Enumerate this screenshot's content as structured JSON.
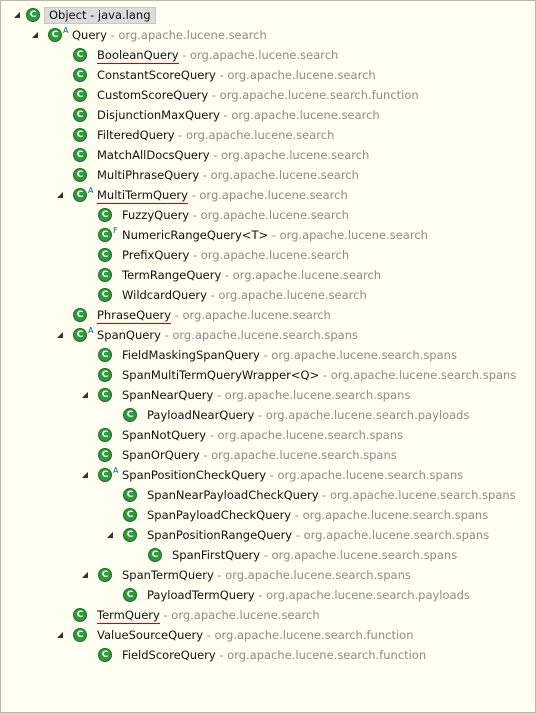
{
  "root": {
    "label": "Object - java.lang"
  },
  "rows": [
    {
      "id": "query",
      "name": "Query",
      "pkg": "org.apache.lucene.search",
      "level": 1,
      "expand": "open",
      "mod": "A",
      "underline": false
    },
    {
      "id": "boolean-query",
      "name": "BooleanQuery",
      "pkg": "org.apache.lucene.search",
      "level": 2,
      "expand": "none",
      "mod": "",
      "underline": true
    },
    {
      "id": "constant-score-query",
      "name": "ConstantScoreQuery",
      "pkg": "org.apache.lucene.search",
      "level": 2,
      "expand": "none",
      "mod": "",
      "underline": false
    },
    {
      "id": "custom-score-query",
      "name": "CustomScoreQuery",
      "pkg": "org.apache.lucene.search.function",
      "level": 2,
      "expand": "none",
      "mod": "",
      "underline": false
    },
    {
      "id": "disjunction-max-query",
      "name": "DisjunctionMaxQuery",
      "pkg": "org.apache.lucene.search",
      "level": 2,
      "expand": "none",
      "mod": "",
      "underline": false
    },
    {
      "id": "filtered-query",
      "name": "FilteredQuery",
      "pkg": "org.apache.lucene.search",
      "level": 2,
      "expand": "none",
      "mod": "",
      "underline": false
    },
    {
      "id": "match-all-docs-query",
      "name": "MatchAllDocsQuery",
      "pkg": "org.apache.lucene.search",
      "level": 2,
      "expand": "none",
      "mod": "",
      "underline": false
    },
    {
      "id": "multi-phrase-query",
      "name": "MultiPhraseQuery",
      "pkg": "org.apache.lucene.search",
      "level": 2,
      "expand": "none",
      "mod": "",
      "underline": false
    },
    {
      "id": "multi-term-query",
      "name": "MultiTermQuery",
      "pkg": "org.apache.lucene.search",
      "level": 2,
      "expand": "open",
      "mod": "A",
      "underline": true
    },
    {
      "id": "fuzzy-query",
      "name": "FuzzyQuery",
      "pkg": "org.apache.lucene.search",
      "level": 3,
      "expand": "none",
      "mod": "",
      "underline": false
    },
    {
      "id": "numeric-range-query",
      "name": "NumericRangeQuery<T>",
      "pkg": "org.apache.lucene.search",
      "level": 3,
      "expand": "none",
      "mod": "F",
      "underline": false
    },
    {
      "id": "prefix-query",
      "name": "PrefixQuery",
      "pkg": "org.apache.lucene.search",
      "level": 3,
      "expand": "none",
      "mod": "",
      "underline": false
    },
    {
      "id": "term-range-query",
      "name": "TermRangeQuery",
      "pkg": "org.apache.lucene.search",
      "level": 3,
      "expand": "none",
      "mod": "",
      "underline": false
    },
    {
      "id": "wildcard-query",
      "name": "WildcardQuery",
      "pkg": "org.apache.lucene.search",
      "level": 3,
      "expand": "none",
      "mod": "",
      "underline": false
    },
    {
      "id": "phrase-query",
      "name": "PhraseQuery",
      "pkg": "org.apache.lucene.search",
      "level": 2,
      "expand": "none",
      "mod": "",
      "underline": true
    },
    {
      "id": "span-query",
      "name": "SpanQuery",
      "pkg": "org.apache.lucene.search.spans",
      "level": 2,
      "expand": "open",
      "mod": "A",
      "underline": false
    },
    {
      "id": "field-masking-span-query",
      "name": "FieldMaskingSpanQuery",
      "pkg": "org.apache.lucene.search.spans",
      "level": 3,
      "expand": "none",
      "mod": "",
      "underline": false
    },
    {
      "id": "span-multi-term-query-wrapper",
      "name": "SpanMultiTermQueryWrapper<Q>",
      "pkg": "org.apache.lucene.search.spans",
      "level": 3,
      "expand": "none",
      "mod": "",
      "underline": false
    },
    {
      "id": "span-near-query",
      "name": "SpanNearQuery",
      "pkg": "org.apache.lucene.search.spans",
      "level": 3,
      "expand": "open",
      "mod": "",
      "underline": false
    },
    {
      "id": "payload-near-query",
      "name": "PayloadNearQuery",
      "pkg": "org.apache.lucene.search.payloads",
      "level": 4,
      "expand": "none",
      "mod": "",
      "underline": false
    },
    {
      "id": "span-not-query",
      "name": "SpanNotQuery",
      "pkg": "org.apache.lucene.search.spans",
      "level": 3,
      "expand": "none",
      "mod": "",
      "underline": false
    },
    {
      "id": "span-or-query",
      "name": "SpanOrQuery",
      "pkg": "org.apache.lucene.search.spans",
      "level": 3,
      "expand": "none",
      "mod": "",
      "underline": false
    },
    {
      "id": "span-position-check-query",
      "name": "SpanPositionCheckQuery",
      "pkg": "org.apache.lucene.search.spans",
      "level": 3,
      "expand": "open",
      "mod": "A",
      "underline": false
    },
    {
      "id": "span-near-payload-check-query",
      "name": "SpanNearPayloadCheckQuery",
      "pkg": "org.apache.lucene.search.spans",
      "level": 4,
      "expand": "none",
      "mod": "",
      "underline": false
    },
    {
      "id": "span-payload-check-query",
      "name": "SpanPayloadCheckQuery",
      "pkg": "org.apache.lucene.search.spans",
      "level": 4,
      "expand": "none",
      "mod": "",
      "underline": false
    },
    {
      "id": "span-position-range-query",
      "name": "SpanPositionRangeQuery",
      "pkg": "org.apache.lucene.search.spans",
      "level": 4,
      "expand": "open",
      "mod": "",
      "underline": false
    },
    {
      "id": "span-first-query",
      "name": "SpanFirstQuery",
      "pkg": "org.apache.lucene.search.spans",
      "level": 5,
      "expand": "none",
      "mod": "",
      "underline": false
    },
    {
      "id": "span-term-query",
      "name": "SpanTermQuery",
      "pkg": "org.apache.lucene.search.spans",
      "level": 3,
      "expand": "open",
      "mod": "",
      "underline": false
    },
    {
      "id": "payload-term-query",
      "name": "PayloadTermQuery",
      "pkg": "org.apache.lucene.search.payloads",
      "level": 4,
      "expand": "none",
      "mod": "",
      "underline": false
    },
    {
      "id": "term-query",
      "name": "TermQuery",
      "pkg": "org.apache.lucene.search",
      "level": 2,
      "expand": "none",
      "mod": "",
      "underline": true
    },
    {
      "id": "value-source-query",
      "name": "ValueSourceQuery",
      "pkg": "org.apache.lucene.search.function",
      "level": 2,
      "expand": "open",
      "mod": "",
      "underline": false
    },
    {
      "id": "field-score-query",
      "name": "FieldScoreQuery",
      "pkg": "org.apache.lucene.search.function",
      "level": 3,
      "expand": "none",
      "mod": "",
      "underline": false
    }
  ],
  "separator": " - ",
  "colors": {
    "class_icon": "#2e9a3a",
    "package_text": "#8b8b8b",
    "underline": "#d40000",
    "background": "#fffef0",
    "root_highlight": "#dcdcdc"
  }
}
